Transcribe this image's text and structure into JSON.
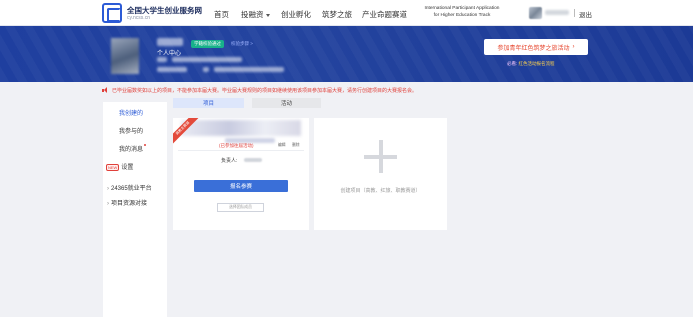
{
  "header": {
    "site_title": "全国大学生创业服务网",
    "site_url": "cy.ncss.cn",
    "nav": [
      {
        "label": "首页"
      },
      {
        "label": "投融资"
      },
      {
        "label": "创业孵化"
      },
      {
        "label": "筑梦之旅"
      },
      {
        "label": "产业命题赛道"
      }
    ],
    "intl_line1": "International Participant Application",
    "intl_line2": "for Higher Education Track",
    "logout": "退出"
  },
  "banner": {
    "user_center": "个人中心",
    "tag_verified": "学籍校验通过",
    "tag_link": "校验步骤 >",
    "cta_label": "参加青年红色筑梦之旅活动",
    "cta_arrow": "›",
    "cta_note_prefix": "必看:",
    "cta_note_link": "红色活动报名流程"
  },
  "notice": {
    "text": "已毕业届数奖如以上的项目，不能参加本届大赛。毕业届大赛规则的项目如继续使用该项目参加本届大赛，请务行创建项目的大赛报名会。"
  },
  "sidebar": {
    "items": [
      {
        "label": "我创建的"
      },
      {
        "label": "我参与的"
      },
      {
        "label": "我的消息"
      },
      {
        "label": "设置",
        "badge": "NEW"
      }
    ],
    "external": [
      {
        "label": "24365就业平台"
      },
      {
        "label": "项目资源对接"
      }
    ]
  },
  "tabs": [
    {
      "label": "项目"
    },
    {
      "label": "活动"
    }
  ],
  "project_card": {
    "ribbon": "高教主赛道",
    "status": "(已参加往届活动)",
    "action_edit": "编辑",
    "action_delete": "删除",
    "owner_label": "负责人:",
    "register_button": "报名参赛",
    "invite_button": "选择团队成员"
  },
  "create_card": {
    "label": "创建项目（高教、红旅、职教赛道）"
  },
  "colors": {
    "brand_blue": "#2c5bd6",
    "banner_bg": "#1f3f9f",
    "alert_red": "#e0403a",
    "verify_green": "#18b18a"
  }
}
